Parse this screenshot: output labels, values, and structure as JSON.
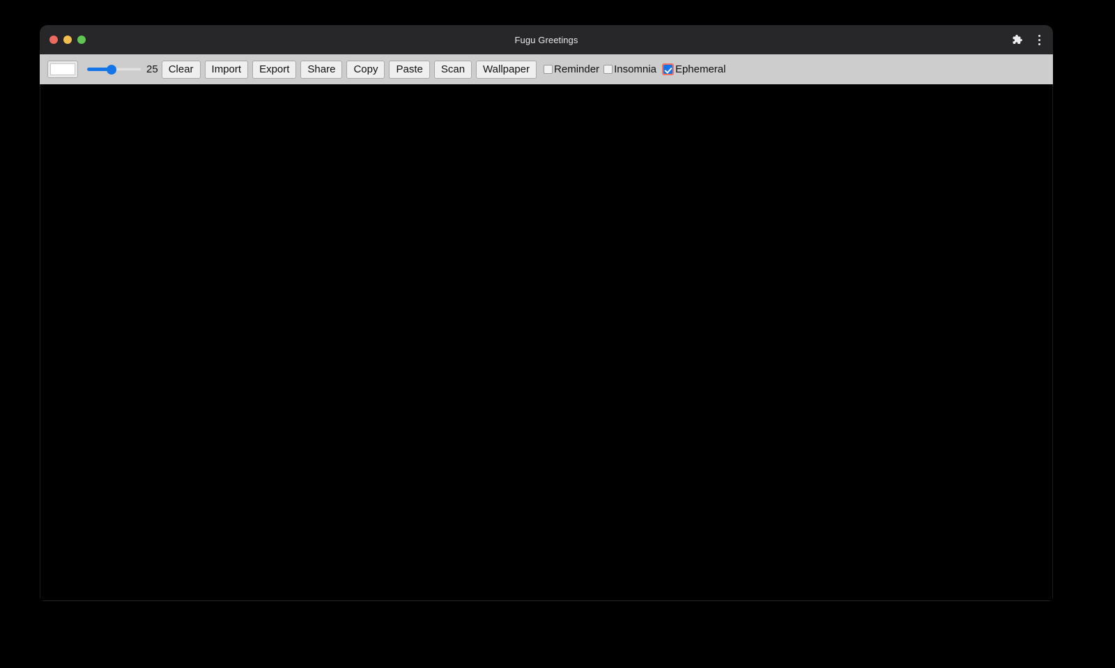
{
  "window": {
    "title": "Fugu Greetings",
    "traffic_lights": [
      {
        "name": "close",
        "color": "#ED6A5E"
      },
      {
        "name": "minimize",
        "color": "#F4BD4F"
      },
      {
        "name": "maximize",
        "color": "#61C554"
      }
    ],
    "right_icons": [
      {
        "name": "extensions-icon",
        "glyph": "puzzle"
      },
      {
        "name": "browser-menu-icon",
        "glyph": "kebab"
      }
    ]
  },
  "toolbar": {
    "color_picker": {
      "label": "color",
      "value": "#FFFFFF"
    },
    "slider": {
      "label": "line width",
      "value": "25",
      "min": "1",
      "max": "50",
      "percent": 45,
      "accent": "#1375E8"
    },
    "buttons": [
      {
        "name": "clear-button",
        "label": "Clear"
      },
      {
        "name": "import-button",
        "label": "Import"
      },
      {
        "name": "export-button",
        "label": "Export"
      },
      {
        "name": "share-button",
        "label": "Share"
      },
      {
        "name": "copy-button",
        "label": "Copy"
      },
      {
        "name": "paste-button",
        "label": "Paste"
      },
      {
        "name": "scan-button",
        "label": "Scan"
      },
      {
        "name": "wallpaper-button",
        "label": "Wallpaper"
      }
    ],
    "checkboxes": [
      {
        "name": "reminder-checkbox",
        "label": "Reminder",
        "checked": false,
        "focused": false
      },
      {
        "name": "insomnia-checkbox",
        "label": "Insomnia",
        "checked": false,
        "focused": false
      },
      {
        "name": "ephemeral-checkbox",
        "label": "Ephemeral",
        "checked": true,
        "focused": true
      }
    ]
  },
  "canvas": {
    "name": "drawing-canvas",
    "background": "#000000",
    "content": ""
  },
  "colors": {
    "accent": "#1375E8",
    "toolbar_bg": "#CDCDCD",
    "titlebar_bg": "#272729",
    "focus_ring": "#F1705F",
    "desktop_bg": "#000000"
  }
}
